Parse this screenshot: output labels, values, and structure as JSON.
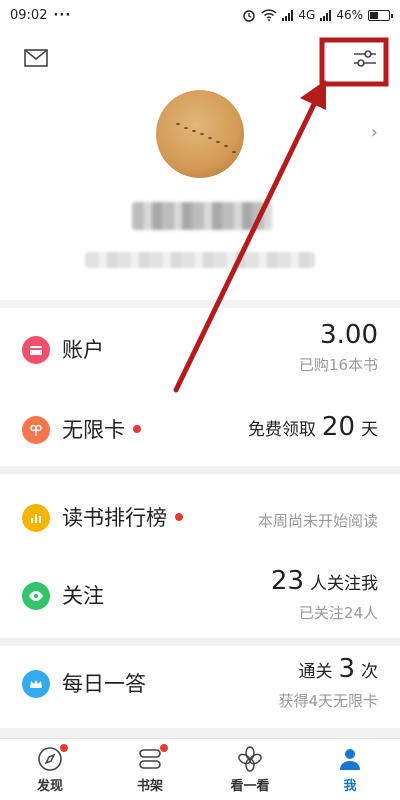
{
  "status_bar": {
    "time": "09:02",
    "dots": "···",
    "network": "4G",
    "battery": "46%"
  },
  "profile": {
    "chevron": "›"
  },
  "rows": {
    "account": {
      "title": "账户",
      "value": "3.00",
      "sub": "已购16本书"
    },
    "unlimited": {
      "title": "无限卡",
      "prefix": "免费领取",
      "value": "20",
      "suffix": "天"
    },
    "ranking": {
      "title": "读书排行榜",
      "sub": "本周尚未开始阅读"
    },
    "follow": {
      "title": "关注",
      "value": "23",
      "suffix": "人关注我",
      "sub": "已关注24人"
    },
    "daily": {
      "title": "每日一答",
      "prefix": "通关",
      "value": "3",
      "suffix": "次",
      "sub": "获得4天无限卡"
    }
  },
  "bottom_nav": [
    {
      "label": "发现",
      "icon": "compass-icon"
    },
    {
      "label": "书架",
      "icon": "bookshelf-icon"
    },
    {
      "label": "看一看",
      "icon": "flower-icon"
    },
    {
      "label": "我",
      "icon": "user-icon"
    }
  ],
  "colors": {
    "account_icon": "#f0516a",
    "unlimited_icon": "#f4764c",
    "ranking_icon": "#f5b400",
    "follow_icon": "#33c46a",
    "daily_icon": "#34aaf0",
    "annotation": "#b41c1c",
    "active_nav": "#1976d2"
  }
}
